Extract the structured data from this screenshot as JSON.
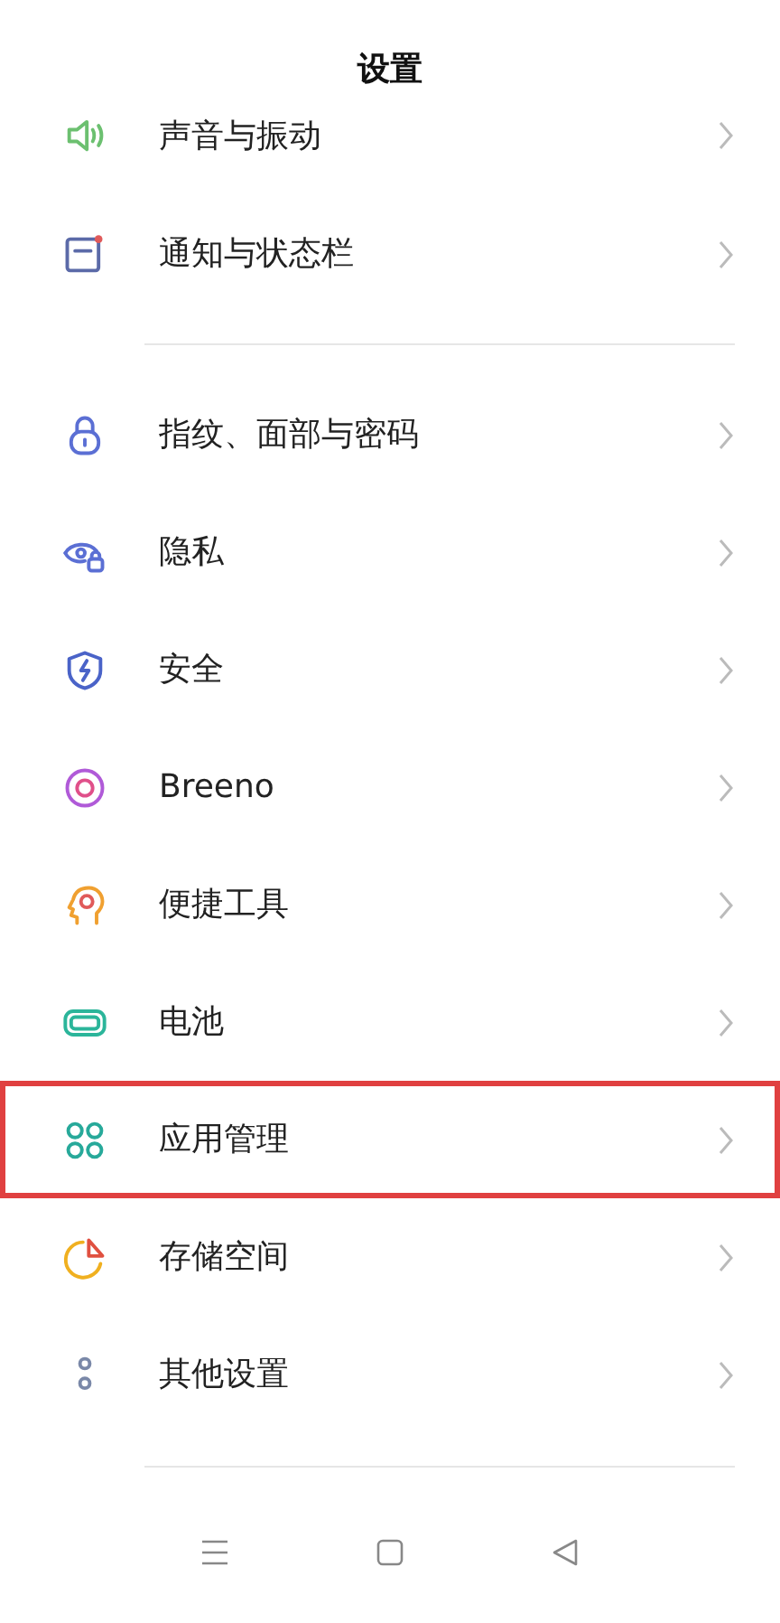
{
  "header": {
    "title": "设置"
  },
  "groups": [
    {
      "items": [
        {
          "label": "声音与振动",
          "highlighted": false
        },
        {
          "label": "通知与状态栏",
          "highlighted": false
        }
      ]
    },
    {
      "items": [
        {
          "label": "指纹、面部与密码",
          "highlighted": false
        },
        {
          "label": "隐私",
          "highlighted": false
        },
        {
          "label": "安全",
          "highlighted": false
        },
        {
          "label": "Breeno",
          "highlighted": false
        },
        {
          "label": "便捷工具",
          "highlighted": false
        },
        {
          "label": "电池",
          "highlighted": false
        },
        {
          "label": "应用管理",
          "highlighted": true
        },
        {
          "label": "存储空间",
          "highlighted": false
        },
        {
          "label": "其他设置",
          "highlighted": false
        }
      ]
    }
  ]
}
